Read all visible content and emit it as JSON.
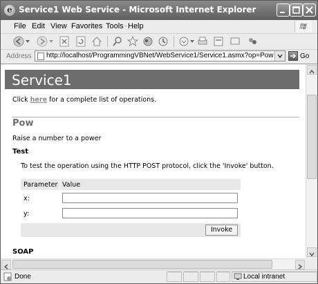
{
  "window": {
    "title": "Service1 Web Service - Microsoft Internet Explorer",
    "app_icon_glyph": "e"
  },
  "menu": {
    "items": [
      "File",
      "Edit",
      "View",
      "Favorites",
      "Tools",
      "Help"
    ]
  },
  "toolbar": {
    "icons": [
      "back-icon",
      "forward-icon",
      "stop-icon",
      "refresh-icon",
      "home-icon",
      "search-icon",
      "favorites-icon",
      "media-icon",
      "history-icon",
      "mail-icon",
      "print-icon",
      "edit-icon",
      "discuss-icon",
      "messenger-icon"
    ]
  },
  "address": {
    "label": "Address",
    "url": "http://localhost/ProgrammingVBNet/WebService1/Service1.asmx?op=Pow",
    "go_label": "Go"
  },
  "page": {
    "service_name": "Service1",
    "intro_pre": "Click",
    "intro_link": "here",
    "intro_post": "for a complete list of operations.",
    "operation_name": "Pow",
    "operation_desc": "Raise a number to a power",
    "test_heading": "Test",
    "test_instructions": "To test the operation using the HTTP POST protocol, click the 'Invoke' button.",
    "table": {
      "col_param": "Parameter",
      "col_value": "Value",
      "params": [
        {
          "name": "x:",
          "value": ""
        },
        {
          "name": "y:",
          "value": ""
        }
      ],
      "invoke_label": "Invoke"
    },
    "soap_heading": "SOAP"
  },
  "status": {
    "text": "Done",
    "zone": "Local intranet"
  }
}
